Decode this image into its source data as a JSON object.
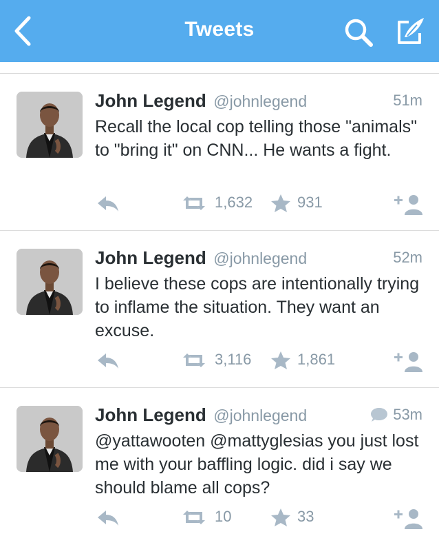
{
  "header": {
    "title": "Tweets"
  },
  "tweets": [
    {
      "name": "John Legend",
      "handle": "@johnlegend",
      "time": "51m",
      "text": "Recall the local cop telling those \"animals\" to \"bring it\" on CNN...  He wants a fight.",
      "retweets": "1,632",
      "favorites": "931",
      "is_reply": false
    },
    {
      "name": "John Legend",
      "handle": "@johnlegend",
      "time": "52m",
      "text": "I believe these cops are intentionally trying to inflame the situation.  They want an excuse.",
      "retweets": "3,116",
      "favorites": "1,861",
      "is_reply": false
    },
    {
      "name": "John Legend",
      "handle": "@johnlegend",
      "time": "53m",
      "text": "@yattawooten @mattyglesias you just lost me with your baffling logic.  did i say we should blame all cops?",
      "retweets": "10",
      "favorites": "33",
      "is_reply": true
    }
  ],
  "icons": {
    "back": "chevron-left-icon",
    "search": "search-icon",
    "compose": "compose-icon",
    "reply": "reply-icon",
    "retweet": "retweet-icon",
    "favorite": "star-icon",
    "follow": "follow-icon",
    "conversation": "speech-bubble-icon"
  },
  "colors": {
    "brand": "#55acee",
    "muted": "#8899a6",
    "action_icon": "#a8b8c6",
    "text": "#292f33"
  }
}
